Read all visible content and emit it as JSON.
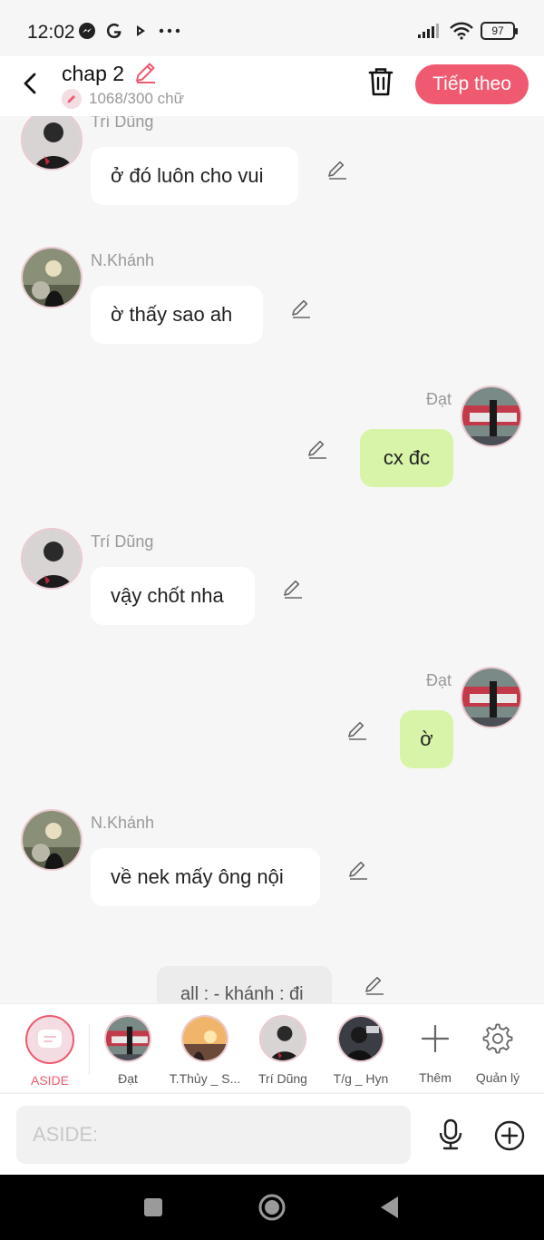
{
  "status_bar": {
    "time": "12:02",
    "battery": "97"
  },
  "header": {
    "title": "chap 2",
    "word_count": "1068/300 chữ",
    "next_label": "Tiếp theo"
  },
  "messages": [
    {
      "sender": "Trí Dũng",
      "text": "ở đó luôn cho vui",
      "side": "left"
    },
    {
      "sender": "N.Khánh",
      "text": "ờ thấy sao ah",
      "side": "left"
    },
    {
      "sender": "Đạt",
      "text": "cx đc",
      "side": "right"
    },
    {
      "sender": "Trí Dũng",
      "text": "vậy chốt nha",
      "side": "left"
    },
    {
      "sender": "Đạt",
      "text": "ờ",
      "side": "right"
    },
    {
      "sender": "N.Khánh",
      "text": "về nek mấy ông nội",
      "side": "left"
    },
    {
      "sender": "",
      "text": "all : - khánh : đi",
      "side": "center"
    }
  ],
  "characters": [
    {
      "label": "ASIDE"
    },
    {
      "label": "Đạt"
    },
    {
      "label": "T.Thủy _ S..."
    },
    {
      "label": "Trí Dũng"
    },
    {
      "label": "T/g _ Hyn"
    },
    {
      "label": "Thêm"
    },
    {
      "label": "Quản lý"
    }
  ],
  "input": {
    "placeholder": "ASIDE:"
  },
  "colors": {
    "accent": "#ef5a70",
    "green_bubble": "#d8f4a8",
    "background": "#f6f6f6"
  }
}
